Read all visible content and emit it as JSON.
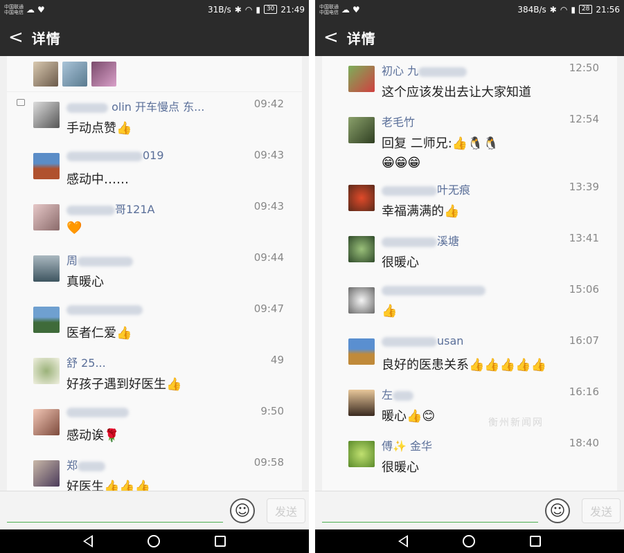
{
  "left": {
    "status": {
      "carrier1": "中国联通",
      "carrier2": "中国电信",
      "speed": "31B/s",
      "battery": "30",
      "clock": "21:49"
    },
    "header": {
      "back": "<",
      "title": "详情"
    },
    "rows": [
      {
        "name_suffix": "olin 开车慢点 东...",
        "time": "09:42",
        "msg": "手动点赞👍"
      },
      {
        "name_suffix": "019",
        "time": "09:43",
        "msg": "感动中……"
      },
      {
        "name_suffix": "哥121A",
        "time": "09:43",
        "msg": "🧡"
      },
      {
        "name_suffix": "周",
        "time": "09:44",
        "msg": "真暖心"
      },
      {
        "name_suffix": "",
        "time": "09:47",
        "msg": "医者仁爱👍"
      },
      {
        "name_suffix": "舒 25...",
        "time": "49",
        "msg": "好孩子遇到好医生👍"
      },
      {
        "name_suffix": "",
        "time": "9:50",
        "msg": "感动诶🌹"
      },
      {
        "name_suffix": "郑",
        "time": "09:58",
        "msg": "好医生👍👍👍"
      }
    ],
    "input": {
      "send": "发送"
    }
  },
  "right": {
    "status": {
      "speed": "384B/s",
      "battery": "28",
      "clock": "21:56"
    },
    "header": {
      "back": "<",
      "title": "详情"
    },
    "rows": [
      {
        "name": "初心 九",
        "time": "12:50",
        "msg": "这个应该发出去让大家知道"
      },
      {
        "name": "老毛竹",
        "time": "12:54",
        "msg": "回复 二师兄:👍🐧🐧",
        "msg2": "😁😁😁"
      },
      {
        "name": "叶无痕",
        "time": "13:39",
        "msg": "幸福满满的👍"
      },
      {
        "name": "溪塘",
        "time": "13:41",
        "msg": "很暖心"
      },
      {
        "name": "",
        "time": "15:06",
        "msg": "👍"
      },
      {
        "name": "usan",
        "time": "16:07",
        "msg": "良好的医患关系👍👍👍👍👍"
      },
      {
        "name": "左",
        "time": "16:16",
        "msg": "暖心👍😊"
      },
      {
        "name": "傅✨ 金华",
        "time": "18:40",
        "msg": "很暖心"
      }
    ],
    "input": {
      "send": "发送"
    },
    "watermark": "衡州新闻网"
  },
  "colors": {
    "bar": "#2b2b2b",
    "name": "#5a6f99",
    "accent": "#4caf50"
  }
}
